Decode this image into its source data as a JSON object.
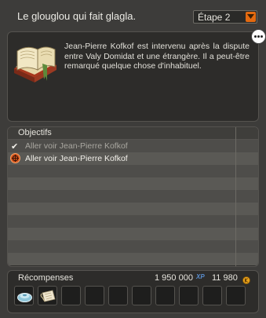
{
  "header": {
    "quest_title": "Le glouglou qui fait glagla.",
    "step_selected": "Étape 2"
  },
  "description": {
    "text": "Jean-Pierre Kofkof est intervenu après la dispute entre Valy Domidat et une étrangère. Il a peut-être remarqué quelque chose d'inhabituel."
  },
  "objectives": {
    "header": "Objectifs",
    "items": [
      {
        "label": "Aller voir Jean-Pierre Kofkof",
        "status": "done",
        "icon": "check-icon"
      },
      {
        "label": "Aller voir Jean-Pierre Kofkof",
        "status": "active",
        "icon": "target-icon"
      }
    ],
    "row_count": 10
  },
  "rewards": {
    "title": "Récompenses",
    "xp": "1 950 000",
    "xp_icon_label": "XP",
    "kamas": "11 980",
    "slots": [
      {
        "icon": "potion-icon"
      },
      {
        "icon": "scroll-icon"
      },
      {
        "icon": ""
      },
      {
        "icon": ""
      },
      {
        "icon": ""
      },
      {
        "icon": ""
      },
      {
        "icon": ""
      },
      {
        "icon": ""
      },
      {
        "icon": ""
      },
      {
        "icon": ""
      }
    ]
  },
  "colors": {
    "accent_orange": "#e36a10",
    "panel_bg": "#2d2c2a",
    "window_bg": "#3d3c3a"
  }
}
